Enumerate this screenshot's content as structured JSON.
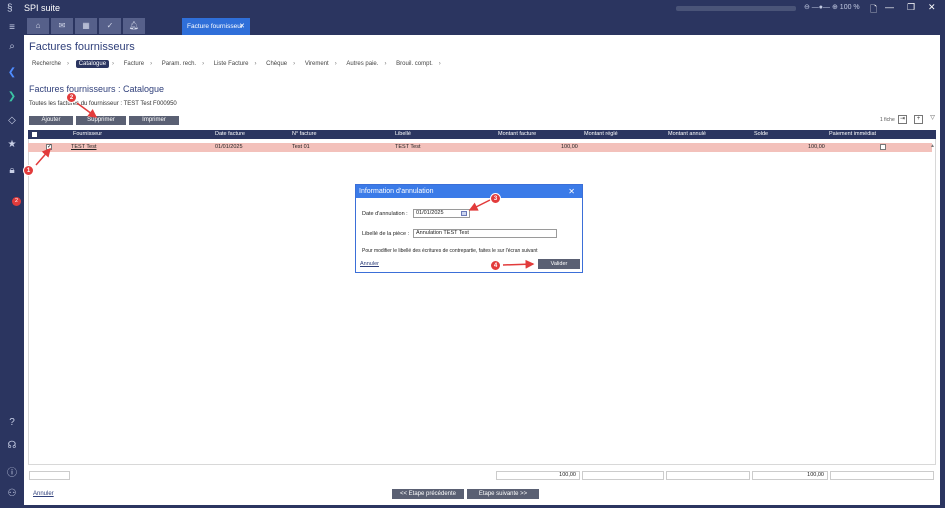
{
  "app": {
    "title": "SPI suite",
    "zoom": "100 %"
  },
  "tabs": {
    "active_label": "Facture fournisseur"
  },
  "page": {
    "title": "Factures fournisseurs",
    "subtitle": "Factures fournisseurs : Catalogue",
    "filter_text": "Toutes les factures du fournisseur : TEST Test F000950"
  },
  "breadcrumb": [
    "Recherche",
    "Catalogue",
    "Facture",
    "Param. rech.",
    "Liste Facture",
    "Chèque",
    "Virement",
    "Autres paie.",
    "Brouil. compt."
  ],
  "toolbar": {
    "add": "Ajouter",
    "delete": "Supprimer",
    "print": "Imprimer",
    "count": "1 fiche"
  },
  "grid": {
    "columns": [
      "Fournisseur",
      "Date facture",
      "N° facture",
      "Libellé",
      "Montant facture",
      "Montant réglé",
      "Montant annulé",
      "Solde",
      "Paiement immédiat"
    ],
    "rows": [
      {
        "fournisseur": "TEST Test",
        "date": "01/01/2025",
        "numero": "Test 01",
        "libelle": "TEST Test",
        "montant": "100,00",
        "regle": "",
        "annule": "",
        "solde": "100,00"
      }
    ],
    "totals": {
      "montant": "100,00",
      "solde": "100,00"
    }
  },
  "footer": {
    "cancel": "Annuler",
    "prev": "<< Etape précédente",
    "next": "Etape suivante >>"
  },
  "dialog": {
    "title": "Information d'annulation",
    "date_label": "Date d'annulation :",
    "date_value": "01/01/2025",
    "libelle_label": "Libellé de la pièce :",
    "libelle_value": "Annulation TEST Test",
    "note": "Pour modifier le libellé des écritures de contrepartie, faites le sur l'écran suivant",
    "cancel": "Annuler",
    "validate": "Valider"
  },
  "annotations": [
    "1",
    "2",
    "3",
    "4"
  ],
  "colors": {
    "sidebar": "#2b3560",
    "accent": "#2f6fd9",
    "row_selected": "#f3c1bb",
    "marker": "#e23b3b",
    "button": "#5a6073"
  }
}
